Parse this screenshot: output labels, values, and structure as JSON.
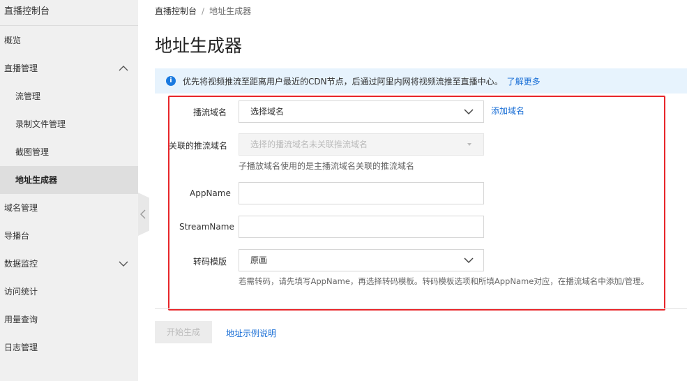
{
  "sidebar": {
    "title": "直播控制台",
    "items": [
      {
        "label": "概览"
      },
      {
        "label": "直播管理",
        "expanded": true
      },
      {
        "label": "流管理"
      },
      {
        "label": "录制文件管理"
      },
      {
        "label": "截图管理"
      },
      {
        "label": "地址生成器",
        "active": true
      },
      {
        "label": "域名管理"
      },
      {
        "label": "导播台"
      },
      {
        "label": "数据监控",
        "expanded": false
      },
      {
        "label": "访问统计"
      },
      {
        "label": "用量查询"
      },
      {
        "label": "日志管理"
      }
    ]
  },
  "breadcrumb": {
    "root": "直播控制台",
    "separator": "/",
    "current": "地址生成器"
  },
  "page_title": "地址生成器",
  "notice": {
    "text": "优先将视频推流至距离用户最近的CDN节点，后通过阿里内网将视频流推至直播中心。",
    "link": "了解更多"
  },
  "form": {
    "push_domain": {
      "label": "播流域名",
      "value": "选择域名",
      "add_link": "添加域名"
    },
    "related_domain": {
      "label": "关联的推流域名",
      "placeholder": "选择的播流域名未关联推流域名",
      "hint": "子播放域名使用的是主播流域名关联的推流域名"
    },
    "app_name": {
      "label": "AppName",
      "value": ""
    },
    "stream_name": {
      "label": "StreamName",
      "value": ""
    },
    "transcode": {
      "label": "转码模版",
      "value": "原画",
      "hint": "若需转码，请先填写AppName，再选择转码模板。转码模板选项和所填AppName对应，在播流域名中添加/管理。"
    }
  },
  "actions": {
    "start": "开始生成",
    "example_link": "地址示例说明"
  },
  "colors": {
    "link": "#1a6fd6",
    "highlight_border": "#e8262a",
    "notice_bg": "#e7f3fd",
    "info_icon": "#1a7ae0"
  }
}
